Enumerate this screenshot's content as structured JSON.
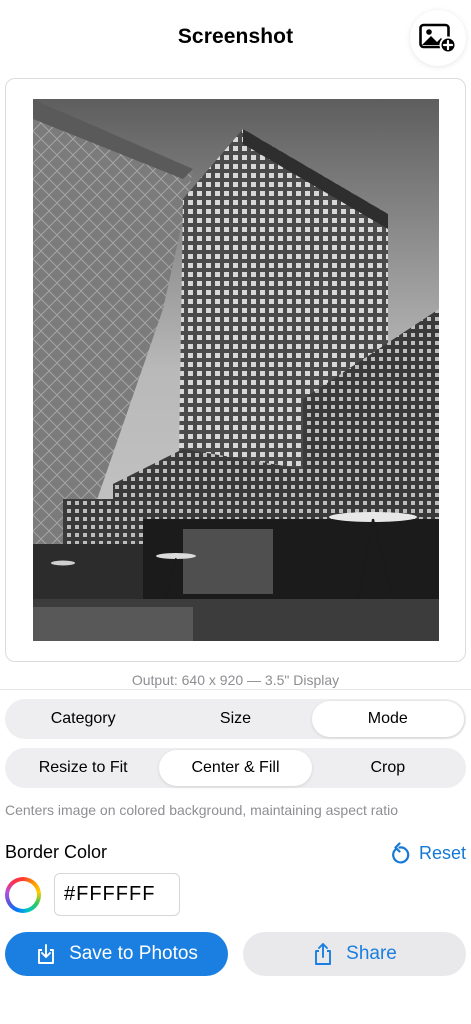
{
  "header": {
    "title": "Screenshot",
    "add_photo_icon": "photo-badge-plus-icon"
  },
  "preview": {
    "output": "Output: 640 x 920 — 3.5\" Display"
  },
  "segments_top": [
    "Category",
    "Size",
    "Mode"
  ],
  "segments_top_selected": "Mode",
  "segments_mode": [
    "Resize to Fit",
    "Center & Fill",
    "Crop"
  ],
  "segments_mode_selected": "Center & Fill",
  "mode_description": "Centers image on colored background, maintaining aspect ratio",
  "border": {
    "label": "Border Color",
    "reset_label": "Reset",
    "hex_value": "#FFFFFF"
  },
  "actions": {
    "save_label": "Save to Photos",
    "share_label": "Share"
  },
  "colors": {
    "accent": "#1a7fe0",
    "secondary_text": "#8e8e93"
  }
}
